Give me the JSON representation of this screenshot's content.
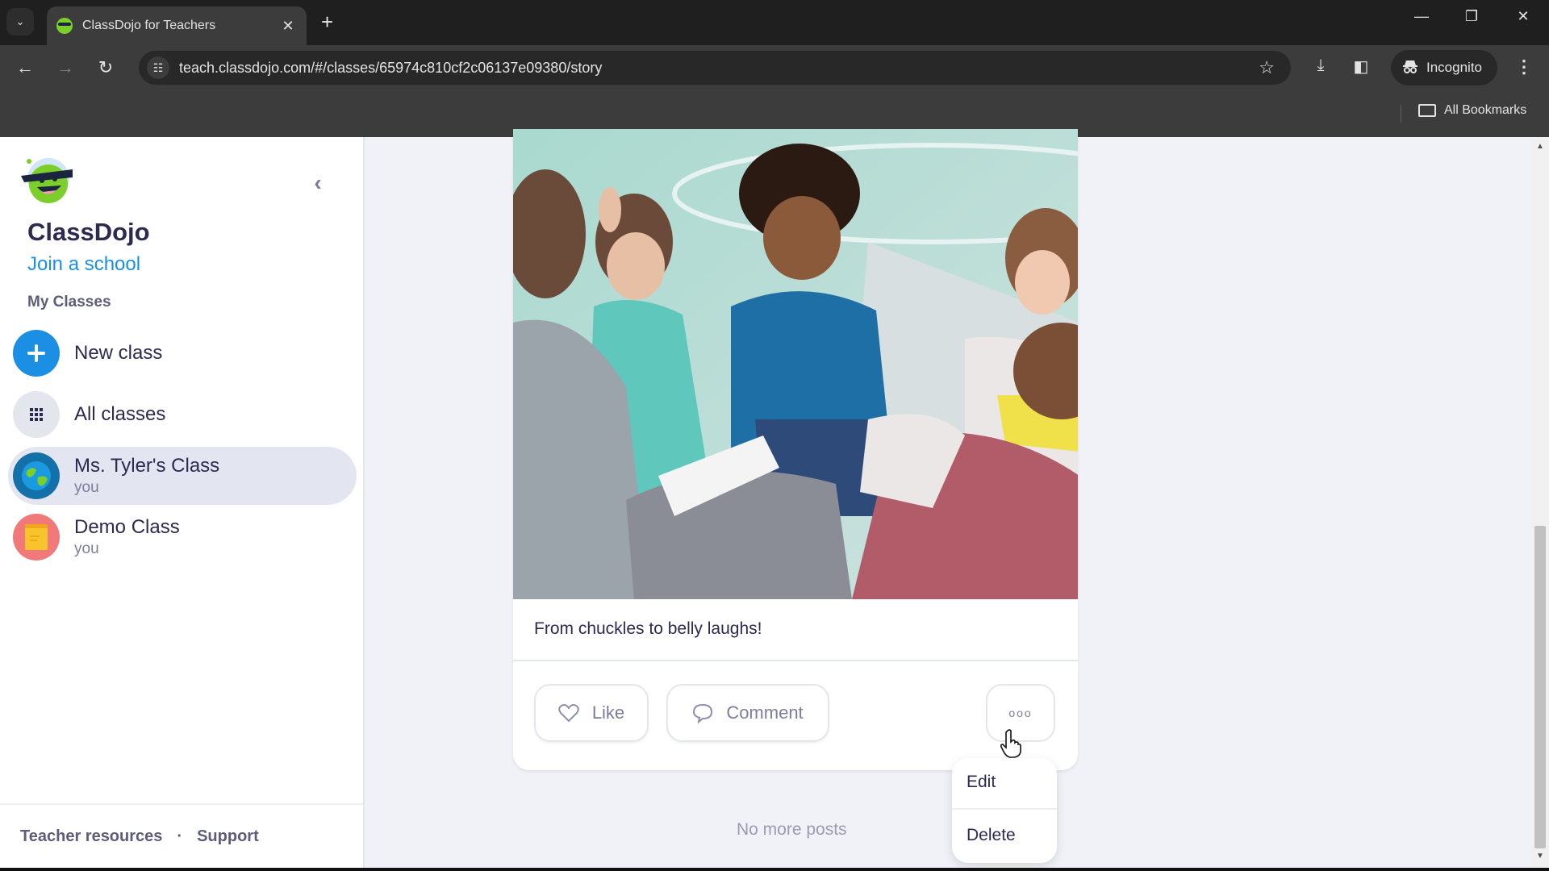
{
  "browser": {
    "tab_title": "ClassDojo for Teachers",
    "url": "teach.classdojo.com/#/classes/65974c810cf2c06137e09380/story",
    "incognito_label": "Incognito",
    "all_bookmarks_label": "All Bookmarks",
    "icons": {
      "tab_search": "chevron-down-icon",
      "close_tab": "close-icon",
      "new_tab": "plus-icon",
      "minimize": "minimize-icon",
      "restore": "restore-icon",
      "close_window": "close-icon",
      "back": "arrow-left-icon",
      "forward": "arrow-right-icon",
      "reload": "reload-icon",
      "site_info": "tune-icon",
      "bookmark": "star-icon",
      "downloads": "download-icon",
      "side_panel": "side-panel-icon",
      "incognito": "incognito-icon",
      "menu": "kebab-icon",
      "bookmarks_folder": "folder-icon"
    },
    "glyphs": {
      "tab_search": "⌄",
      "close_tab": "✕",
      "new_tab": "+",
      "minimize": "—",
      "restore": "❐",
      "close_window": "✕",
      "back": "←",
      "forward": "→",
      "reload": "↻",
      "site_info": "☷",
      "bookmark": "☆",
      "downloads": "⤓",
      "side_panel": "◧",
      "incognito": "🕵",
      "menu": "⋮"
    }
  },
  "sidebar": {
    "brand": "ClassDojo",
    "join_school": "Join a school",
    "section_title": "My Classes",
    "collapse_glyph": "‹",
    "items": [
      {
        "label": "New class",
        "icon": "plus-icon",
        "color": "#1a8fe3"
      },
      {
        "label": "All classes",
        "icon": "grid-icon",
        "color": "#e4e6ee"
      },
      {
        "label": "Ms. Tyler's Class",
        "sub": "you",
        "icon": "globe-icon",
        "color": "#1470a8",
        "active": true
      },
      {
        "label": "Demo Class",
        "sub": "you",
        "icon": "notebook-icon",
        "color": "#f2797a"
      }
    ],
    "footer": {
      "teacher_resources": "Teacher resources",
      "separator": "·",
      "support": "Support"
    }
  },
  "post": {
    "caption": "From chuckles to belly laughs!",
    "like_label": "Like",
    "comment_label": "Comment",
    "more_glyph": "ooo",
    "photo_description": "Children laughing while sitting on the floor with a teacher"
  },
  "feed": {
    "end_message": "No more posts"
  },
  "post_menu": {
    "items": [
      "Edit",
      "Delete"
    ]
  },
  "colors": {
    "brand_blue": "#1a8fe3",
    "text_dark": "#2c2a50",
    "text_muted": "#7c7d9c",
    "active_item_bg": "#e3e5f1"
  }
}
